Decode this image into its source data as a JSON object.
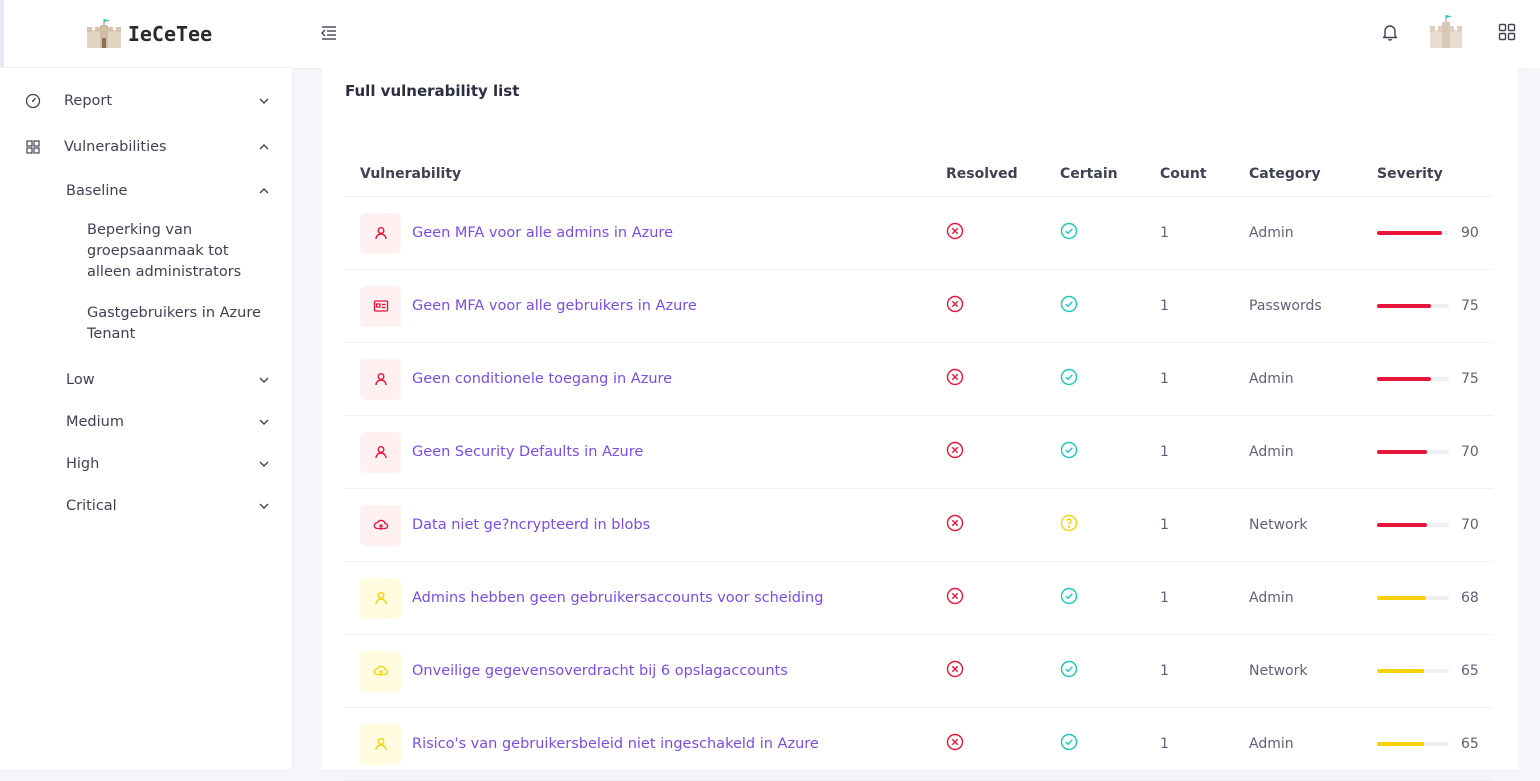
{
  "app": {
    "name": "IeCeTee"
  },
  "sidebar": {
    "items": [
      {
        "label": "Report",
        "icon": "gauge-icon",
        "expanded": false
      },
      {
        "label": "Vulnerabilities",
        "icon": "grid-icon",
        "expanded": true
      }
    ],
    "baseline": {
      "label": "Baseline",
      "expanded": true
    },
    "baseline_leaves": [
      {
        "line1": "Beperking van",
        "line2": "groepsaanmaak tot",
        "line3": "alleen administrators"
      },
      {
        "line1": "Gastgebruikers in Azure",
        "line2": "Tenant"
      }
    ],
    "levels": [
      {
        "label": "Low"
      },
      {
        "label": "Medium"
      },
      {
        "label": "High"
      },
      {
        "label": "Critical"
      }
    ]
  },
  "header": {
    "menu_icon": "menu-collapse-icon",
    "bell_icon": "bell-icon",
    "apps_icon": "apps-grid-icon"
  },
  "main": {
    "title": "Full vulnerability list",
    "columns": {
      "vulnerability": "Vulnerability",
      "resolved": "Resolved",
      "certain": "Certain",
      "count": "Count",
      "category": "Category",
      "severity": "Severity"
    },
    "rows": [
      {
        "name": "Geen MFA voor alle admins in Azure",
        "icon": "user-icon",
        "tone": "red",
        "resolved": false,
        "certain": "yes",
        "count": "1",
        "category": "Admin",
        "severity": "90"
      },
      {
        "name": "Geen MFA voor alle gebruikers in Azure",
        "icon": "id-card-icon",
        "tone": "red",
        "resolved": false,
        "certain": "yes",
        "count": "1",
        "category": "Passwords",
        "severity": "75"
      },
      {
        "name": "Geen conditionele toegang in Azure",
        "icon": "user-icon",
        "tone": "red",
        "resolved": false,
        "certain": "yes",
        "count": "1",
        "category": "Admin",
        "severity": "75"
      },
      {
        "name": "Geen Security Defaults in Azure",
        "icon": "user-icon",
        "tone": "red",
        "resolved": false,
        "certain": "yes",
        "count": "1",
        "category": "Admin",
        "severity": "70"
      },
      {
        "name": "Data niet ge?ncrypteerd in blobs",
        "icon": "cloud-icon",
        "tone": "red",
        "resolved": false,
        "certain": "unknown",
        "count": "1",
        "category": "Network",
        "severity": "70"
      },
      {
        "name": "Admins hebben geen gebruikersaccounts voor scheiding",
        "icon": "user-icon",
        "tone": "yellow",
        "resolved": false,
        "certain": "yes",
        "count": "1",
        "category": "Admin",
        "severity": "68"
      },
      {
        "name": "Onveilige gegevensoverdracht bij 6 opslagaccounts",
        "icon": "cloud-icon",
        "tone": "yellow",
        "resolved": false,
        "certain": "yes",
        "count": "1",
        "category": "Network",
        "severity": "65"
      },
      {
        "name": "Risico's van gebruikersbeleid niet ingeschakeld in Azure",
        "icon": "user-icon",
        "tone": "yellow",
        "resolved": false,
        "certain": "yes",
        "count": "1",
        "category": "Admin",
        "severity": "65"
      }
    ]
  },
  "colors": {
    "accent": "#7b4ce6",
    "danger": "#e8153a",
    "success": "#19c7b8",
    "warning": "#f5d20a",
    "danger_bg": "#fff0f2",
    "warning_bg": "#fffce0"
  }
}
